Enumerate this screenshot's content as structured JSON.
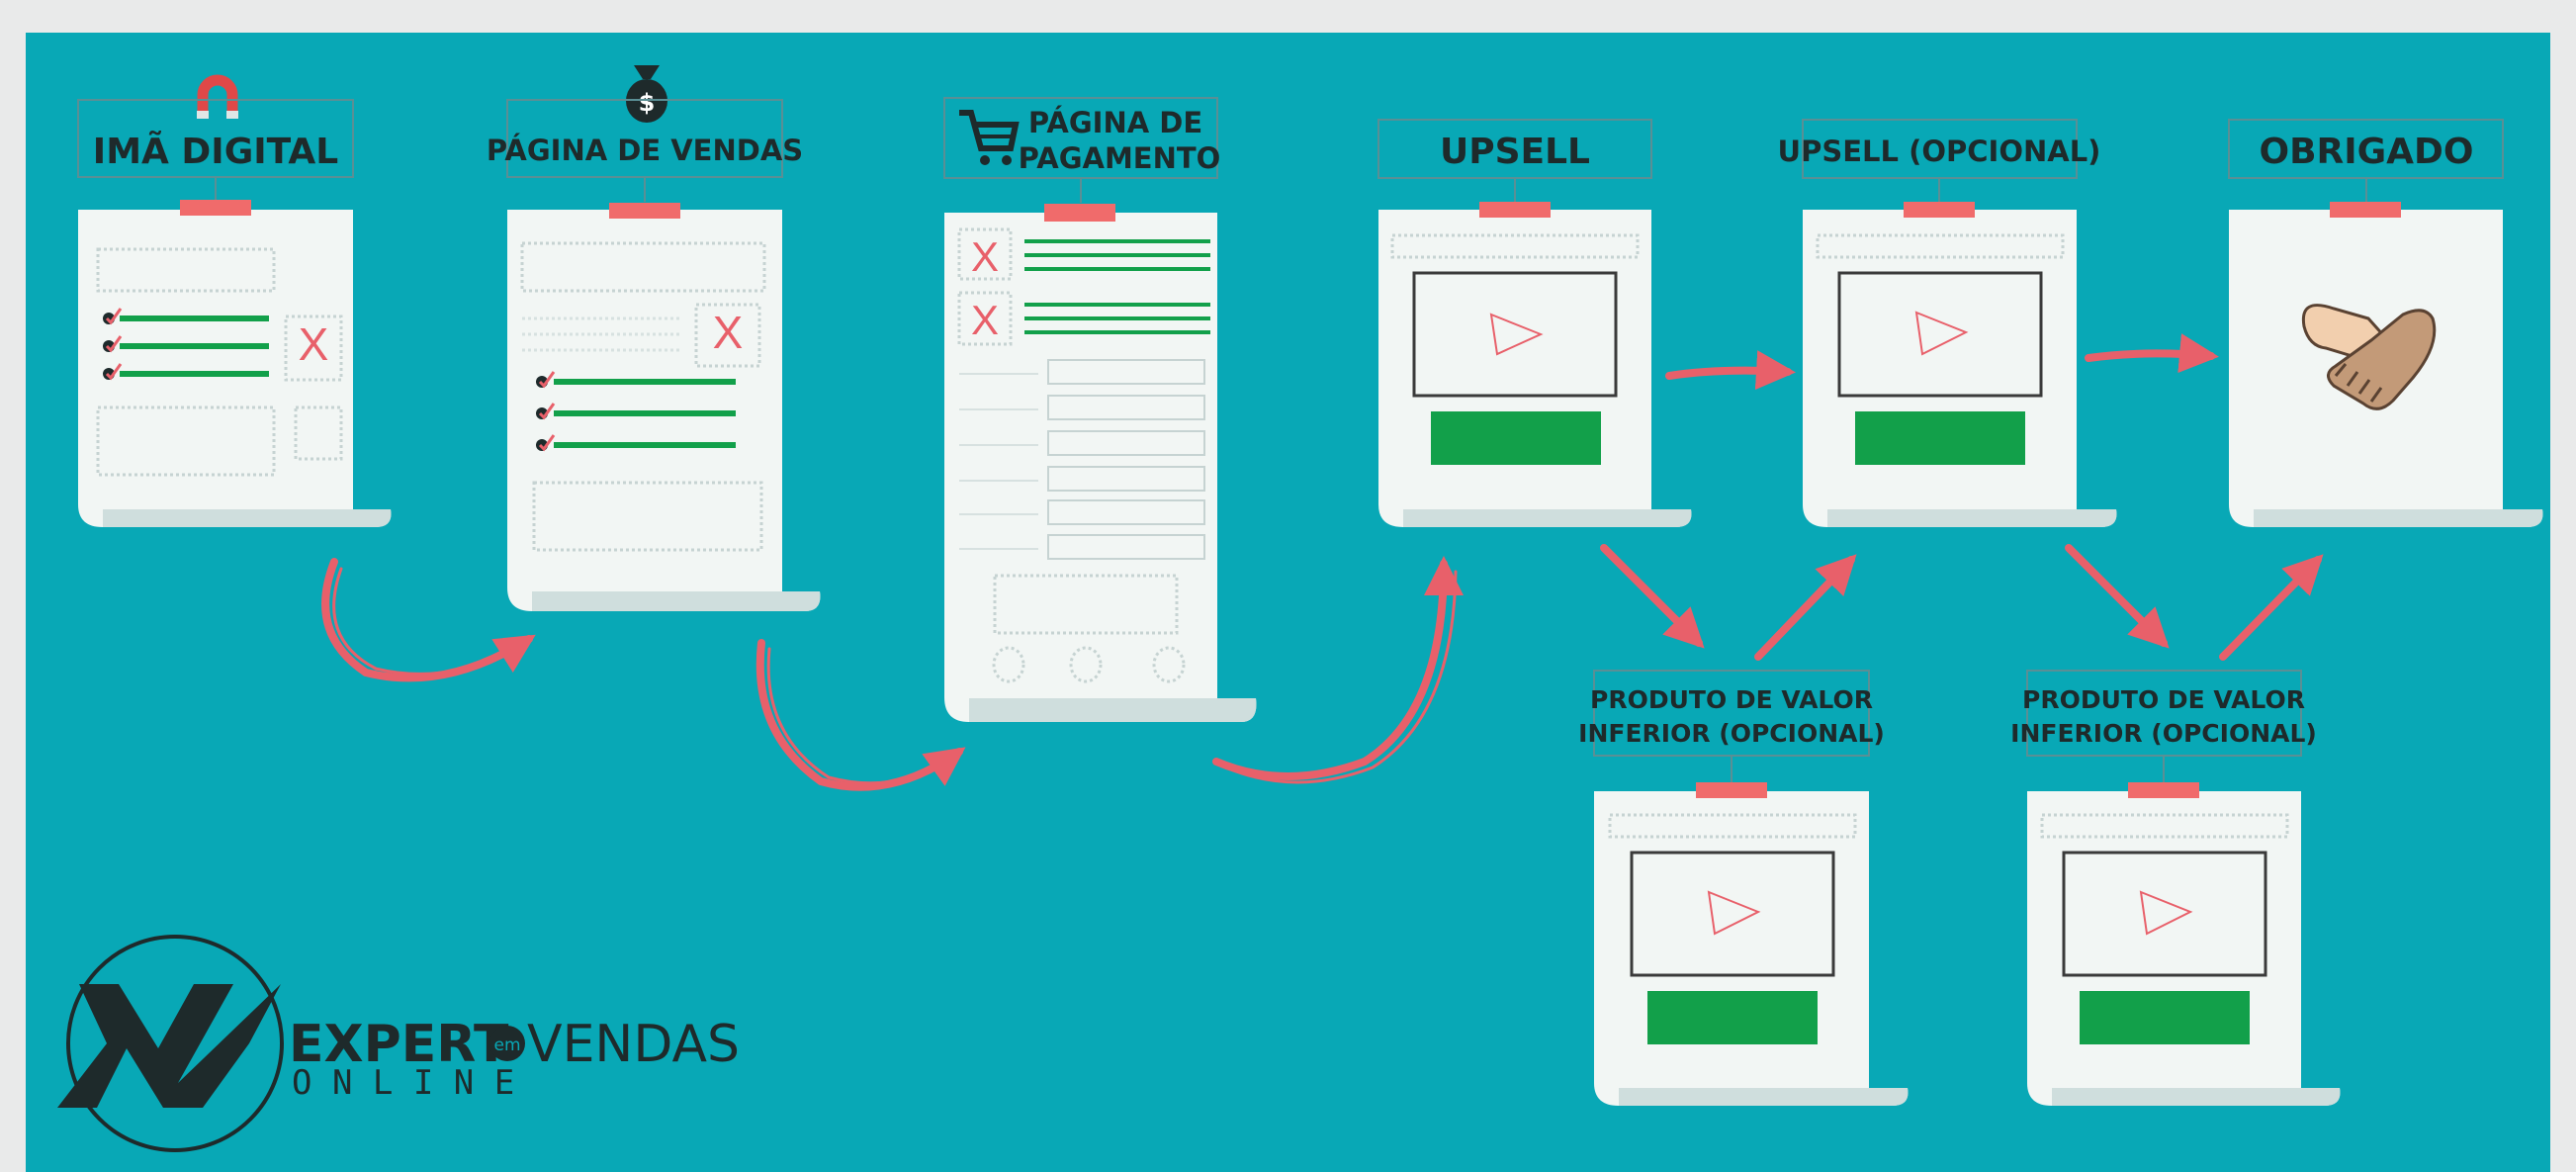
{
  "colors": {
    "background": "#08a8b6",
    "outer_frame": "#e9eaea",
    "paper": "#f2f6f4",
    "paper_curl": "#cfdedd",
    "clip": "#f06b6b",
    "arrow": "#e8606a",
    "green": "#12a04a",
    "dark": "#1e2a2b",
    "label_border": "#5a8f95"
  },
  "funnel": {
    "steps": [
      {
        "key": "ima",
        "title": "IMÃ DIGITAL",
        "icon": "magnet-icon"
      },
      {
        "key": "vendas",
        "title": "PÁGINA DE VENDAS",
        "icon": "money-bag-icon"
      },
      {
        "key": "pagamento",
        "title_line1": "PÁGINA DE",
        "title_line2": "PAGAMENTO",
        "icon": "shopping-cart-icon"
      },
      {
        "key": "upsell",
        "title": "UPSELL"
      },
      {
        "key": "upsell2",
        "title": "UPSELL (OPCIONAL)"
      },
      {
        "key": "obrigado",
        "title": "OBRIGADO",
        "icon": "handshake-icon"
      }
    ],
    "downsells": [
      {
        "title_line1": "PRODUTO DE VALOR",
        "title_line2": "INFERIOR (OPCIONAL)"
      },
      {
        "title_line1": "PRODUTO DE VALOR",
        "title_line2": "INFERIOR (OPCIONAL)"
      }
    ]
  },
  "logo": {
    "brand_main": "EXPERT",
    "brand_em": "em",
    "brand_end": "VENDAS",
    "brand_sub": "O N L I N E"
  }
}
